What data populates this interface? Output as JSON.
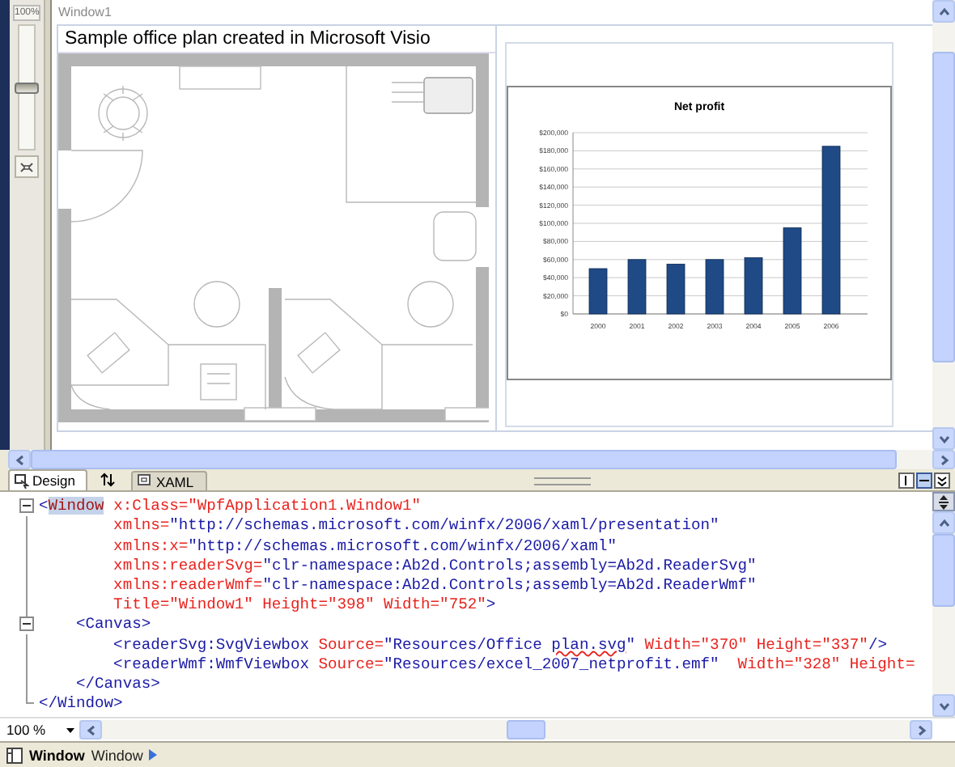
{
  "window": {
    "title": "Window1"
  },
  "zoom_panel": {
    "zoom": "100%",
    "level": 0.5
  },
  "designer": {
    "plan_caption": "Sample office plan created in Microsoft Visio",
    "chart_data": {
      "type": "bar",
      "title": "Net profit",
      "categories": [
        "2000",
        "2001",
        "2002",
        "2003",
        "2004",
        "2005",
        "2006"
      ],
      "series": [
        {
          "color": "#1f4a86",
          "values": [
            50000,
            60000,
            55000,
            60000,
            62000,
            95000,
            185000
          ]
        }
      ],
      "ylim": [
        0,
        200000
      ],
      "grid": true,
      "yticks": [
        {
          "value": 0,
          "label": "$0"
        },
        {
          "value": 20000,
          "label": "$20,000"
        },
        {
          "value": 40000,
          "label": "$40,000"
        },
        {
          "value": 60000,
          "label": "$60,000"
        },
        {
          "value": 80000,
          "label": "$80,000"
        },
        {
          "value": 100000,
          "label": "$100,000"
        },
        {
          "value": 120000,
          "label": "$120,000"
        },
        {
          "value": 140000,
          "label": "$140,000"
        },
        {
          "value": 160000,
          "label": "$160,000"
        },
        {
          "value": 180000,
          "label": "$180,000"
        },
        {
          "value": 200000,
          "label": "$200,000"
        }
      ]
    }
  },
  "view_tabs": [
    {
      "label": "Design",
      "kind": "design",
      "selected": true
    },
    {
      "label": "XAML",
      "kind": "xaml",
      "selected": false
    }
  ],
  "pane_buttons": [
    {
      "kind": "vertical-split",
      "selected": false
    },
    {
      "kind": "horizontal-split",
      "selected": true
    },
    {
      "kind": "collapse",
      "selected": false
    }
  ],
  "code_lines": [
    {
      "kind": "fold-start",
      "tokens": [
        {
          "kind": "markup",
          "text": "<"
        },
        {
          "kind": "element-selected",
          "text": "Window"
        },
        {
          "kind": "attr",
          "text": " x:Class=\"WpfApplication1.Window1\""
        }
      ]
    },
    {
      "kind": "plain",
      "tokens": [
        {
          "kind": "attr",
          "text": "        xmlns="
        },
        {
          "kind": "value",
          "text": "\"http://schemas.microsoft.com/winfx/2006/xaml/presentation\""
        }
      ]
    },
    {
      "kind": "plain",
      "tokens": [
        {
          "kind": "attr",
          "text": "        xmlns:x="
        },
        {
          "kind": "value",
          "text": "\"http://schemas.microsoft.com/winfx/2006/xaml\""
        }
      ]
    },
    {
      "kind": "plain",
      "tokens": [
        {
          "kind": "attr",
          "text": "        xmlns:readerSvg="
        },
        {
          "kind": "value",
          "text": "\"clr-namespace:Ab2d.Controls;assembly=Ab2d.ReaderSvg\""
        }
      ]
    },
    {
      "kind": "plain",
      "tokens": [
        {
          "kind": "attr",
          "text": "        xmlns:readerWmf="
        },
        {
          "kind": "value",
          "text": "\"clr-namespace:Ab2d.Controls;assembly=Ab2d.ReaderWmf\""
        }
      ]
    },
    {
      "kind": "plain",
      "tokens": [
        {
          "kind": "attr",
          "text": "        Title=\"Window1\" Height=\"398\" Width=\"752\""
        },
        {
          "kind": "markup",
          "text": ">"
        }
      ]
    },
    {
      "kind": "fold-start",
      "tokens": [
        {
          "kind": "markup",
          "text": "    <Canvas>"
        }
      ]
    },
    {
      "kind": "plain",
      "tokens": [
        {
          "kind": "markup",
          "text": "        <readerSvg:SvgViewbox "
        },
        {
          "kind": "attr",
          "text": "Source="
        },
        {
          "kind": "value",
          "text": "\"Resources/Office "
        },
        {
          "kind": "misspelled",
          "text": "plan.svg"
        },
        {
          "kind": "value",
          "text": "\""
        },
        {
          "kind": "attr",
          "text": " Width=\"370\" Height=\"337\""
        },
        {
          "kind": "markup",
          "text": "/>"
        }
      ]
    },
    {
      "kind": "plain",
      "tokens": [
        {
          "kind": "markup",
          "text": "        <readerWmf:WmfViewbox "
        },
        {
          "kind": "attr",
          "text": "Source="
        },
        {
          "kind": "value",
          "text": "\"Resources/excel_2007_netprofit.emf\""
        },
        {
          "kind": "attr",
          "text": "  Width=\"328\" Height="
        }
      ]
    },
    {
      "kind": "plain",
      "tokens": [
        {
          "kind": "markup",
          "text": "    </Canvas>"
        }
      ]
    },
    {
      "kind": "fold-end",
      "tokens": [
        {
          "kind": "markup",
          "text": "</Window>"
        }
      ]
    }
  ],
  "zoom_combo": {
    "value": "100 %"
  },
  "status_bar": {
    "items": [
      {
        "kind": "element",
        "text": "Window"
      },
      {
        "kind": "name",
        "text": "Window"
      }
    ]
  }
}
